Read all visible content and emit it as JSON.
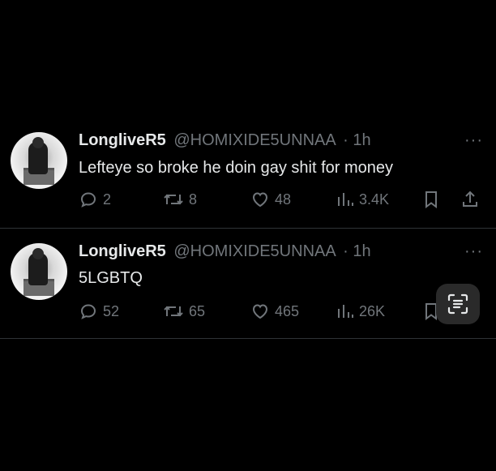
{
  "tweets": [
    {
      "name": "LongliveR5",
      "handle": "@HOMIXIDE5UNNAA",
      "time": "· 1h",
      "text": "Lefteye so broke he doin gay shit for money",
      "replies": "2",
      "reposts": "8",
      "likes": "48",
      "views": "3.4K",
      "more": "···"
    },
    {
      "name": "LongliveR5",
      "handle": "@HOMIXIDE5UNNAA",
      "time": "· 1h",
      "text": "5LGBTQ",
      "replies": "52",
      "reposts": "65",
      "likes": "465",
      "views": "26K",
      "more": "···"
    }
  ],
  "icons": [
    "reply-icon",
    "repost-icon",
    "like-icon",
    "views-icon",
    "bookmark-icon",
    "share-icon",
    "scan-text-icon"
  ],
  "colors": {
    "background": "#000000",
    "text": "#e7e9ea",
    "muted": "#71767b",
    "divider": "#2f3336"
  }
}
